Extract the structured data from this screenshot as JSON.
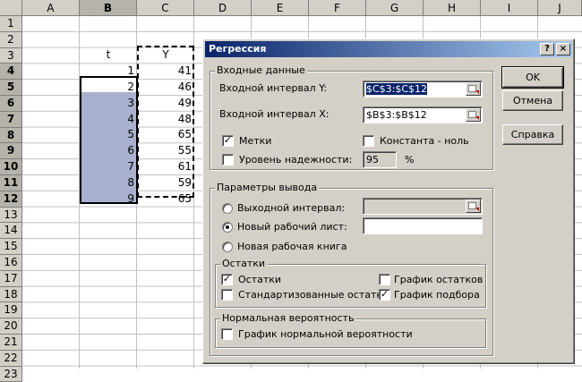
{
  "sheet": {
    "columns": [
      "A",
      "B",
      "C",
      "D",
      "E",
      "F",
      "G",
      "H",
      "I",
      "J"
    ],
    "rows": [
      "1",
      "2",
      "3",
      "4",
      "5",
      "6",
      "7",
      "8",
      "9",
      "10",
      "11",
      "12",
      "13",
      "14",
      "15",
      "16",
      "17",
      "18",
      "19",
      "20",
      "21",
      "22",
      "23"
    ],
    "header_t": "t",
    "header_y": "Y",
    "t_values": [
      "1",
      "2",
      "3",
      "4",
      "5",
      "6",
      "7",
      "8",
      "9"
    ],
    "y_values": [
      "41",
      "46",
      "49",
      "48",
      "65",
      "55",
      "61",
      "59",
      "65"
    ]
  },
  "dialog": {
    "title": "Регрессия",
    "help_btn": "?",
    "close_btn": "×",
    "input_group": "Входные данные",
    "input_y_label": "Входной интервал Y:",
    "input_y_value": "$C$3:$C$12",
    "input_x_label": "Входной интервал X:",
    "input_x_value": "$B$3:$B$12",
    "labels_check": "Метки",
    "labels_checked": true,
    "const_zero_check": "Константа - ноль",
    "const_zero_checked": false,
    "confidence_check": "Уровень надежности:",
    "confidence_checked": false,
    "confidence_value": "95",
    "percent": "%",
    "output_group": "Параметры вывода",
    "output_range_radio": "Выходной интервал:",
    "new_sheet_radio": "Новый рабочий лист:",
    "new_book_radio": "Новая рабочая книга",
    "selected_output": "new_sheet",
    "residuals_group": "Остатки",
    "residuals": "Остатки",
    "residuals_checked": true,
    "std_residuals": "Стандартизованные остатки",
    "std_residuals_checked": false,
    "residual_plot": "График остатков",
    "residual_plot_checked": false,
    "line_fit_plot": "График подбора",
    "line_fit_plot_checked": true,
    "normal_group": "Нормальная вероятность",
    "normal_plot": "График нормальной вероятности",
    "normal_plot_checked": false,
    "ok": "OK",
    "cancel": "Отмена",
    "help": "Справка"
  },
  "colors": {
    "title_start": "#0a246a",
    "title_end": "#a6caf0",
    "dialog_bg": "#d4d0c8",
    "selection_fill": "#a9b1cf"
  }
}
